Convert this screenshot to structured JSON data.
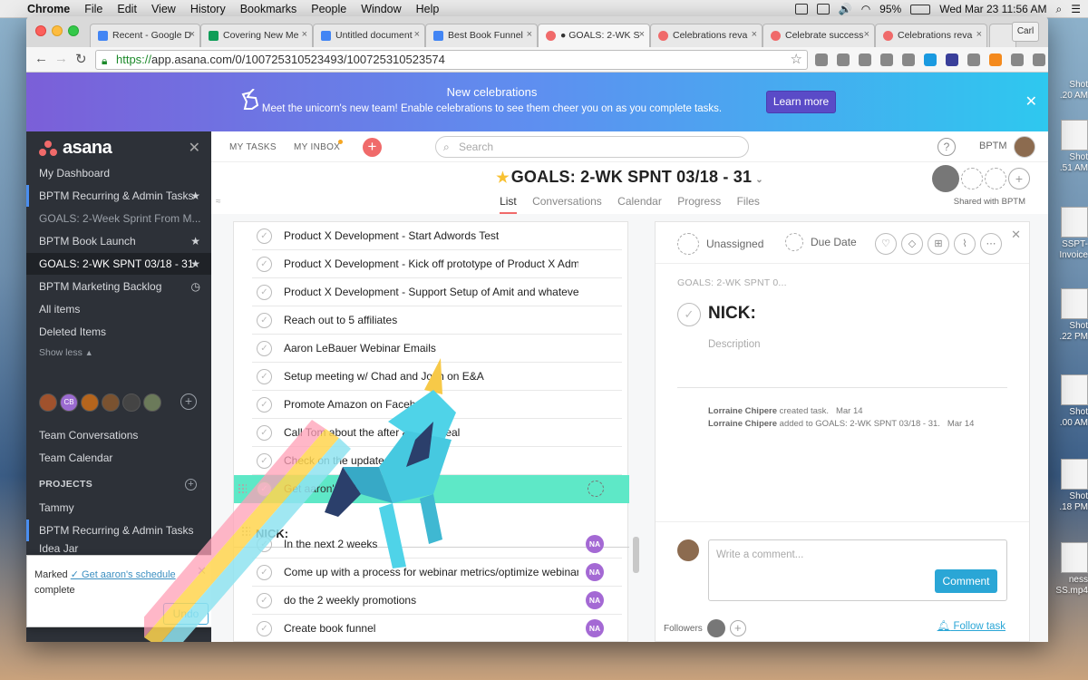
{
  "menubar": {
    "app": "Chrome",
    "items": [
      "File",
      "Edit",
      "View",
      "History",
      "Bookmarks",
      "People",
      "Window",
      "Help"
    ],
    "battery": "95%",
    "clock": "Wed Mar 23  11:56 AM"
  },
  "desktop_files": [
    {
      "line1": "Shot",
      "line2": ".20 AM"
    },
    {
      "line1": "Shot",
      "line2": ".51 AM"
    },
    {
      "line1": "SSPT-",
      "line2": "Invoice"
    },
    {
      "line1": "Shot",
      "line2": ".22 PM"
    },
    {
      "line1": "Shot",
      "line2": ".00 AM"
    },
    {
      "line1": "Shot",
      "line2": ".18 PM"
    },
    {
      "line1": "ness",
      "line2": "SS.mp4"
    }
  ],
  "tabs": [
    {
      "title": "Recent - Google D",
      "color": "#4285f4"
    },
    {
      "title": "Covering New Me",
      "color": "#0f9d58"
    },
    {
      "title": "Untitled document",
      "color": "#4285f4"
    },
    {
      "title": "Best Book Funnel",
      "color": "#4285f4"
    },
    {
      "title": "● GOALS: 2-WK S",
      "color": "#f06a6a"
    },
    {
      "title": "Celebrations reva",
      "color": "#f06a6a"
    },
    {
      "title": "Celebrate success",
      "color": "#f06a6a"
    },
    {
      "title": "Celebrations reva",
      "color": "#f06a6a"
    }
  ],
  "profile_badge": "Carl",
  "url": {
    "scheme": "https://",
    "rest": "app.asana.com/0/100725310523493/100725310523574"
  },
  "banner": {
    "title": "New celebrations",
    "text": "Meet the unicorn's new team! Enable celebrations to see them cheer you on as you complete tasks.",
    "button": "Learn more"
  },
  "sidebar": {
    "logo": "asana",
    "nav": [
      {
        "label": "My Dashboard"
      },
      {
        "label": "BPTM Recurring & Admin Tasks"
      },
      {
        "label": "GOALS: 2-Week Sprint From M..."
      },
      {
        "label": "BPTM Book Launch"
      },
      {
        "label": "GOALS: 2-WK SPNT 03/18 - 31"
      },
      {
        "label": "BPTM Marketing Backlog"
      },
      {
        "label": "All items"
      },
      {
        "label": "Deleted Items"
      }
    ],
    "show_less": "Show less",
    "avatar_initials": "CB",
    "team_links": [
      "Team Conversations",
      "Team Calendar"
    ],
    "projects_header": "PROJECTS",
    "projects": [
      "Tammy",
      "BPTM Recurring & Admin Tasks",
      "Idea Jar"
    ]
  },
  "toast": {
    "prefix": "Marked ",
    "task": "✓ Get aaron's schedule",
    "suffix": "complete",
    "undo": "Undo"
  },
  "topbar": {
    "my_tasks": "MY TASKS",
    "my_inbox": "MY INBOX",
    "search_placeholder": "Search",
    "help": "?",
    "workspace": "BPTM"
  },
  "project": {
    "title": "GOALS: 2-WK SPNT 03/18 - 31",
    "tabs": [
      "List",
      "Conversations",
      "Calendar",
      "Progress",
      "Files"
    ],
    "shared": "Shared with BPTM"
  },
  "tasks": [
    {
      "name": "Product X Development - Start Adwords Test"
    },
    {
      "name": "Product X Development - Kick off prototype of Product X Admin"
    },
    {
      "name": "Product X Development - Support Setup of Amit and whatever is"
    },
    {
      "name": "Reach out to 5 affiliates"
    },
    {
      "name": "Aaron LeBauer Webinar Emails"
    },
    {
      "name": "Setup meeting w/ Chad and Josh on E&A"
    },
    {
      "name": "Promote Amazon on Facebook"
    },
    {
      "name": "Call Tom about the after affiliate deal"
    },
    {
      "name": "Check on the updates"
    }
  ],
  "selected_task": "Get aaron's schedule",
  "section_name": "NICK:",
  "nick_tasks": [
    {
      "name": "In the next 2 weeks",
      "tag": "NA"
    },
    {
      "name": "Come up with a process for webinar metrics/optimize webinars w",
      "tag": "NA"
    },
    {
      "name": "do the 2 weekly promotions",
      "tag": "NA"
    },
    {
      "name": "Create book funnel",
      "tag": "NA"
    }
  ],
  "detail": {
    "assignee": "Unassigned",
    "due": "Due Date",
    "breadcrumb": "GOALS: 2-WK SPNT 0...",
    "title": "NICK:",
    "description_placeholder": "Description",
    "story1": {
      "who": "Lorraine Chipere",
      "what": " created task.",
      "when": "Mar 14"
    },
    "story2": {
      "who": "Lorraine Chipere",
      "what": " added to GOALS: 2-WK SPNT 03/18 - 31.",
      "when": "Mar 14"
    },
    "comment_placeholder": "Write a comment...",
    "comment_button": "Comment",
    "followers": "Followers",
    "follow_task": "Follow task"
  }
}
